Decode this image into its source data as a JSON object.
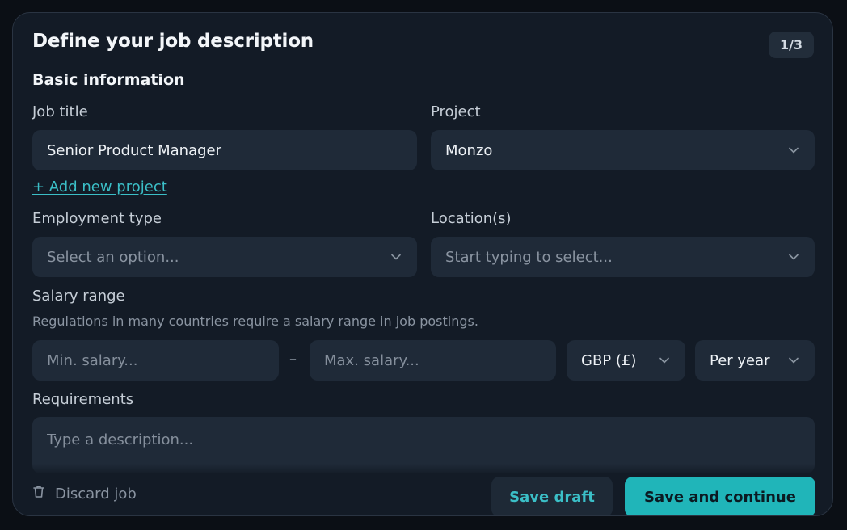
{
  "header": {
    "title": "Define your job description",
    "step": "1/3"
  },
  "basic_info": {
    "heading": "Basic information",
    "job_title": {
      "label": "Job title",
      "value": "Senior Product Manager"
    },
    "project": {
      "label": "Project",
      "value": "Monzo"
    },
    "add_project_link": "+ Add new project",
    "employment_type": {
      "label": "Employment type",
      "placeholder": "Select an option..."
    },
    "locations": {
      "label": "Location(s)",
      "placeholder": "Start typing to select..."
    }
  },
  "salary": {
    "label": "Salary range",
    "hint": "Regulations in many countries require a salary range in job postings.",
    "min_placeholder": "Min. salary...",
    "separator": "–",
    "max_placeholder": "Max. salary...",
    "currency": "GBP (£)",
    "period": "Per year"
  },
  "requirements": {
    "label": "Requirements",
    "placeholder": "Type a description..."
  },
  "footer": {
    "discard_label": "Discard job",
    "save_draft_label": "Save draft",
    "save_continue_label": "Save and continue"
  },
  "icons": {
    "dropdown": "chevron-down-icon",
    "discard": "trash-icon"
  },
  "colors": {
    "accent": "#20b5b9",
    "link": "#3bbfc7",
    "card_bg": "#131b26",
    "field_bg": "#1f2a38"
  }
}
